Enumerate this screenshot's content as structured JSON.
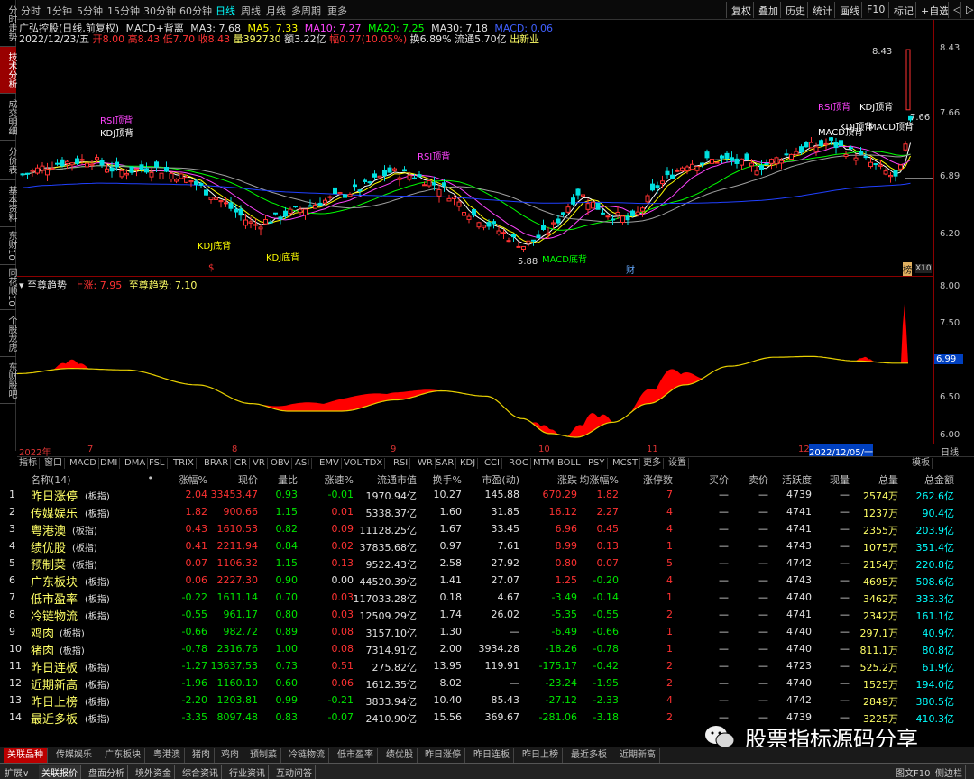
{
  "left_tabs": [
    "分时走势",
    "技术分析",
    "成交明细",
    "分价表",
    "基本资料",
    "东财10",
    "同花顺10",
    "个股龙虎",
    "东财股吧"
  ],
  "top_periods": [
    "分时",
    "1分钟",
    "5分钟",
    "15分钟",
    "30分钟",
    "60分钟",
    "日线",
    "周线",
    "月线",
    "多周期",
    "更多"
  ],
  "top_right_buttons": [
    "复权",
    "叠加",
    "历史",
    "统计",
    "画线",
    "F10",
    "标记",
    "+自选",
    "◁",
    "▷"
  ],
  "chart_info": {
    "line1": {
      "stock": "广弘控股(日线,前复权)",
      "indicator": "MACD+背离",
      "ma3": "MA3: 7.68",
      "ma5": "MA5: 7.33",
      "ma10": "MA10: 7.27",
      "ma20": "MA20: 7.25",
      "ma30": "MA30: 7.18",
      "macd": "MACD: 0.06"
    },
    "line2": {
      "date": "2022/12/23/五",
      "open": "开8.00",
      "high": "高8.43",
      "low": "低7.70",
      "close": "收8.43",
      "vol": "量392730",
      "amount": "额3.22亿",
      "change": "幅0.77(10.05%)",
      "turnover": "换6.89%",
      "float": "流通5.70亿",
      "tag": "出新业"
    }
  },
  "price_axis": [
    "8.43",
    "7.66",
    "6.89",
    "6.20"
  ],
  "price_marks": {
    "high_label": "8.43",
    "low_label": "5.88",
    "right_label": "7.66"
  },
  "chart_annotations": {
    "rsi_top": "RSI顶背",
    "kdj_top": "KDJ顶背",
    "kdj_bottom": "KDJ底背",
    "macd_bottom": "MACD底背",
    "macd_top": "MACD顶背",
    "marker_s": "$",
    "marker_cai": "财",
    "marker_bang": "榜",
    "zoom": "X10"
  },
  "sub_chart": {
    "title": "至尊趋势",
    "up_label": "上涨: 7.95",
    "trend_label": "至尊趋势: 7.10",
    "axis": [
      "8.00",
      "7.50",
      "7.00",
      "6.50",
      "6.00"
    ],
    "current": "6.99"
  },
  "date_axis": {
    "labels": [
      "2022年",
      "7",
      "8",
      "9",
      "10",
      "11",
      "12",
      "2022/12/05/一"
    ],
    "right": "日线"
  },
  "indicator_tabs": [
    "指标",
    "窗口",
    "MACD",
    "DMI",
    "DMA",
    "FSL",
    "TRIX",
    "BRAR",
    "CR",
    "VR",
    "OBV",
    "ASI",
    "EMV",
    "VOL-TDX",
    "RSI",
    "WR",
    "SAR",
    "KDJ",
    "CCI",
    "ROC",
    "MTM",
    "BOLL",
    "PSY",
    "MCST",
    "更多",
    "设置"
  ],
  "indicator_right": "模板",
  "table": {
    "headers": [
      "名称(14)",
      "•",
      "涨幅%",
      "现价",
      "量比",
      "涨速%",
      "流通市值",
      "换手%",
      "市盈(动)",
      "涨跌",
      "均涨幅%",
      "涨停数",
      "买价",
      "卖价",
      "活跃度",
      "现量",
      "总量",
      "总金额"
    ],
    "rows": [
      {
        "n": "1",
        "name": "昨日涨停",
        "tag": "(板指)",
        "chg": "2.04",
        "price": "33453.47",
        "lb": "0.93",
        "spd": "-0.01",
        "mv": "1970.94亿",
        "turn": "10.27",
        "pe": "145.88",
        "diff": "670.29",
        "avg": "1.82",
        "zt": "7",
        "buy": "—",
        "sell": "—",
        "act": "4739",
        "cur": "—",
        "vol": "2574万",
        "amt": "262.6亿",
        "dir": "up",
        "spdDir": "down"
      },
      {
        "n": "2",
        "name": "传媒娱乐",
        "tag": "(板指)",
        "chg": "1.82",
        "price": "900.66",
        "lb": "1.15",
        "spd": "0.01",
        "mv": "5338.37亿",
        "turn": "1.60",
        "pe": "31.85",
        "diff": "16.12",
        "avg": "2.27",
        "zt": "4",
        "buy": "—",
        "sell": "—",
        "act": "4741",
        "cur": "—",
        "vol": "1237万",
        "amt": "90.4亿",
        "dir": "up",
        "spdDir": "up"
      },
      {
        "n": "3",
        "name": "粤港澳",
        "tag": "(板指)",
        "chg": "0.43",
        "price": "1610.53",
        "lb": "0.82",
        "spd": "0.09",
        "mv": "11128.25亿",
        "turn": "1.67",
        "pe": "33.45",
        "diff": "6.96",
        "avg": "0.45",
        "zt": "4",
        "buy": "—",
        "sell": "—",
        "act": "4741",
        "cur": "—",
        "vol": "2355万",
        "amt": "203.9亿",
        "dir": "up",
        "spdDir": "up"
      },
      {
        "n": "4",
        "name": "绩优股",
        "tag": "(板指)",
        "chg": "0.41",
        "price": "2211.94",
        "lb": "0.84",
        "spd": "0.02",
        "mv": "37835.68亿",
        "turn": "0.97",
        "pe": "7.61",
        "diff": "8.99",
        "avg": "0.13",
        "zt": "1",
        "buy": "—",
        "sell": "—",
        "act": "4743",
        "cur": "—",
        "vol": "1075万",
        "amt": "351.4亿",
        "dir": "up",
        "spdDir": "up"
      },
      {
        "n": "5",
        "name": "预制菜",
        "tag": "(板指)",
        "chg": "0.07",
        "price": "1106.32",
        "lb": "1.15",
        "spd": "0.13",
        "mv": "9522.43亿",
        "turn": "2.58",
        "pe": "27.92",
        "diff": "0.80",
        "avg": "0.07",
        "zt": "5",
        "buy": "—",
        "sell": "—",
        "act": "4742",
        "cur": "—",
        "vol": "2154万",
        "amt": "220.8亿",
        "dir": "up",
        "spdDir": "up"
      },
      {
        "n": "6",
        "name": "广东板块",
        "tag": "(板指)",
        "chg": "0.06",
        "price": "2227.30",
        "lb": "0.90",
        "spd": "0.00",
        "mv": "44520.39亿",
        "turn": "1.41",
        "pe": "27.07",
        "diff": "1.25",
        "avg": "-0.20",
        "zt": "4",
        "buy": "—",
        "sell": "—",
        "act": "4743",
        "cur": "—",
        "vol": "4695万",
        "amt": "508.6亿",
        "dir": "up",
        "spdDir": "flat",
        "avgDir": "down"
      },
      {
        "n": "7",
        "name": "低市盈率",
        "tag": "(板指)",
        "chg": "-0.22",
        "price": "1611.14",
        "lb": "0.70",
        "spd": "0.03",
        "mv": "117033.28亿",
        "turn": "0.18",
        "pe": "4.67",
        "diff": "-3.49",
        "avg": "-0.14",
        "zt": "1",
        "buy": "—",
        "sell": "—",
        "act": "4740",
        "cur": "—",
        "vol": "3462万",
        "amt": "333.3亿",
        "dir": "down",
        "spdDir": "up"
      },
      {
        "n": "8",
        "name": "冷链物流",
        "tag": "(板指)",
        "chg": "-0.55",
        "price": "961.17",
        "lb": "0.80",
        "spd": "0.03",
        "mv": "12509.29亿",
        "turn": "1.74",
        "pe": "26.02",
        "diff": "-5.35",
        "avg": "-0.55",
        "zt": "2",
        "buy": "—",
        "sell": "—",
        "act": "4741",
        "cur": "—",
        "vol": "2342万",
        "amt": "161.1亿",
        "dir": "down",
        "spdDir": "up"
      },
      {
        "n": "9",
        "name": "鸡肉",
        "tag": "(板指)",
        "chg": "-0.66",
        "price": "982.72",
        "lb": "0.89",
        "spd": "0.08",
        "mv": "3157.10亿",
        "turn": "1.30",
        "pe": "—",
        "diff": "-6.49",
        "avg": "-0.66",
        "zt": "1",
        "buy": "—",
        "sell": "—",
        "act": "4740",
        "cur": "—",
        "vol": "297.1万",
        "amt": "40.9亿",
        "dir": "down",
        "spdDir": "up"
      },
      {
        "n": "10",
        "name": "猪肉",
        "tag": "(板指)",
        "chg": "-0.78",
        "price": "2316.76",
        "lb": "1.00",
        "spd": "0.08",
        "mv": "7314.91亿",
        "turn": "2.00",
        "pe": "3934.28",
        "diff": "-18.26",
        "avg": "-0.78",
        "zt": "1",
        "buy": "—",
        "sell": "—",
        "act": "4740",
        "cur": "—",
        "vol": "811.1万",
        "amt": "80.8亿",
        "dir": "down",
        "spdDir": "up"
      },
      {
        "n": "11",
        "name": "昨日连板",
        "tag": "(板指)",
        "chg": "-1.27",
        "price": "13637.53",
        "lb": "0.73",
        "spd": "0.51",
        "mv": "275.82亿",
        "turn": "13.95",
        "pe": "119.91",
        "diff": "-175.17",
        "avg": "-0.42",
        "zt": "2",
        "buy": "—",
        "sell": "—",
        "act": "4723",
        "cur": "—",
        "vol": "525.2万",
        "amt": "61.9亿",
        "dir": "down",
        "spdDir": "up"
      },
      {
        "n": "12",
        "name": "近期新高",
        "tag": "(板指)",
        "chg": "-1.96",
        "price": "1160.10",
        "lb": "0.60",
        "spd": "0.06",
        "mv": "1612.35亿",
        "turn": "8.02",
        "pe": "—",
        "diff": "-23.24",
        "avg": "-1.95",
        "zt": "2",
        "buy": "—",
        "sell": "—",
        "act": "4740",
        "cur": "—",
        "vol": "1525万",
        "amt": "194.0亿",
        "dir": "down",
        "spdDir": "up"
      },
      {
        "n": "13",
        "name": "昨日上榜",
        "tag": "(板指)",
        "chg": "-2.20",
        "price": "1203.81",
        "lb": "0.99",
        "spd": "-0.21",
        "mv": "3833.94亿",
        "turn": "10.40",
        "pe": "85.43",
        "diff": "-27.12",
        "avg": "-2.33",
        "zt": "4",
        "buy": "—",
        "sell": "—",
        "act": "4742",
        "cur": "—",
        "vol": "2849万",
        "amt": "380.5亿",
        "dir": "down",
        "spdDir": "down"
      },
      {
        "n": "14",
        "name": "最近多板",
        "tag": "(板指)",
        "chg": "-3.35",
        "price": "8097.48",
        "lb": "0.83",
        "spd": "-0.07",
        "mv": "2410.90亿",
        "turn": "15.56",
        "pe": "369.67",
        "diff": "-281.06",
        "avg": "-3.18",
        "zt": "2",
        "buy": "—",
        "sell": "—",
        "act": "4739",
        "cur": "—",
        "vol": "3225万",
        "amt": "410.3亿",
        "dir": "down",
        "spdDir": "down"
      }
    ]
  },
  "bottom_tabs": [
    "关联品种",
    "传媒娱乐",
    "广东板块",
    "粤港澳",
    "猪肉",
    "鸡肉",
    "预制菜",
    "冷链物流",
    "低市盈率",
    "绩优股",
    "昨日涨停",
    "昨日连板",
    "昨日上榜",
    "最近多板",
    "近期新高"
  ],
  "status_bar": [
    "扩展∨",
    "关联报价",
    "盘面分析",
    "境外资金",
    "综合资讯",
    "行业资讯",
    "互动问答"
  ],
  "status_right": [
    "图文F10",
    "侧边栏"
  ],
  "watermark": "股票指标源码分享",
  "colors": {
    "up": "#ff3232",
    "down": "#00e600",
    "accent": "#8b0000",
    "trend": "#e8d000"
  }
}
